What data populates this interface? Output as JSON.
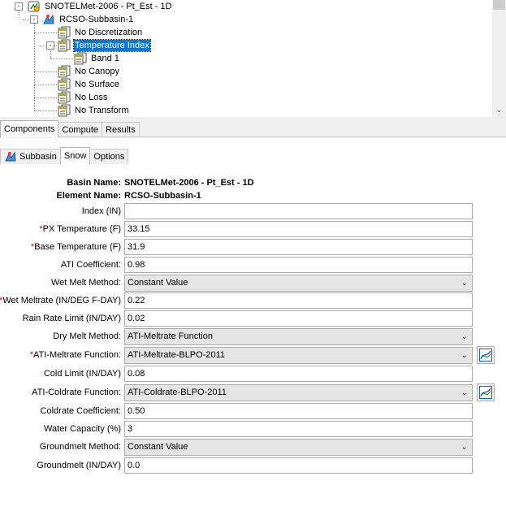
{
  "tree": {
    "items": [
      {
        "label": "SNOTELMet-2006 - Pt_Est - 1D",
        "icon": "basin-model-icon",
        "expander": "-"
      },
      {
        "label": "RCSO-Subbasin-1",
        "icon": "subbasin-icon",
        "expander": "-"
      },
      {
        "label": "No Discretization",
        "icon": "component-sheet-icon"
      },
      {
        "label": "Temperature Index",
        "icon": "component-sheet-icon",
        "expander": "-",
        "selected": true
      },
      {
        "label": "Band 1",
        "icon": "component-sheet-icon"
      },
      {
        "label": "No Canopy",
        "icon": "component-sheet-icon"
      },
      {
        "label": "No Surface",
        "icon": "component-sheet-icon"
      },
      {
        "label": "No Loss",
        "icon": "component-sheet-icon"
      },
      {
        "label": "No Transform",
        "icon": "component-sheet-icon"
      }
    ]
  },
  "bottom_tabs": [
    "Components",
    "Compute",
    "Results"
  ],
  "editor_tabs": [
    "Subbasin",
    "Snow",
    "Options"
  ],
  "form": {
    "basin_name_label": "Basin Name:",
    "basin_name": "SNOTELMet-2006 - Pt_Est - 1D",
    "element_name_label": "Element Name:",
    "element_name": "RCSO-Subbasin-1",
    "index_label": "Index (IN)",
    "index_value": "",
    "px_temp_label": "PX Temperature (F)",
    "px_temp_value": "33.15",
    "base_temp_label": "Base Temperature (F)",
    "base_temp_value": "31.9",
    "ati_coef_label": "ATI Coefficient:",
    "ati_coef_value": "0.98",
    "wet_melt_method_label": "Wet Melt Method:",
    "wet_melt_method_value": "Constant Value",
    "wet_meltrate_label": "Wet Meltrate (IN/DEG F-DAY)",
    "wet_meltrate_value": "0.22",
    "rain_rate_label": "Rain Rate Limit (IN/DAY)",
    "rain_rate_value": "0.02",
    "dry_melt_method_label": "Dry Melt Method:",
    "dry_melt_method_value": "ATI-Meltrate Function",
    "ati_meltrate_label": "ATI-Meltrate Function:",
    "ati_meltrate_value": "ATI-Meltrate-BLPO-2011",
    "cold_limit_label": "Cold Limit (IN/DAY)",
    "cold_limit_value": "0.08",
    "ati_coldrate_label": "ATI-Coldrate Function:",
    "ati_coldrate_value": "ATI-Coldrate-BLPO-2011",
    "coldrate_coef_label": "Coldrate Coefficient:",
    "coldrate_coef_value": "0.50",
    "water_capacity_label": "Water Capacity (%)",
    "water_capacity_value": "3",
    "groundmelt_method_label": "Groundmelt Method:",
    "groundmelt_method_value": "Constant Value",
    "groundmelt_label": "Groundmelt (IN/DAY)",
    "groundmelt_value": "0.0",
    "required_marker": "*"
  },
  "colors": {
    "selection": "#0078d7",
    "required": "#e00000",
    "graph_icon": "#1a5fb4"
  }
}
